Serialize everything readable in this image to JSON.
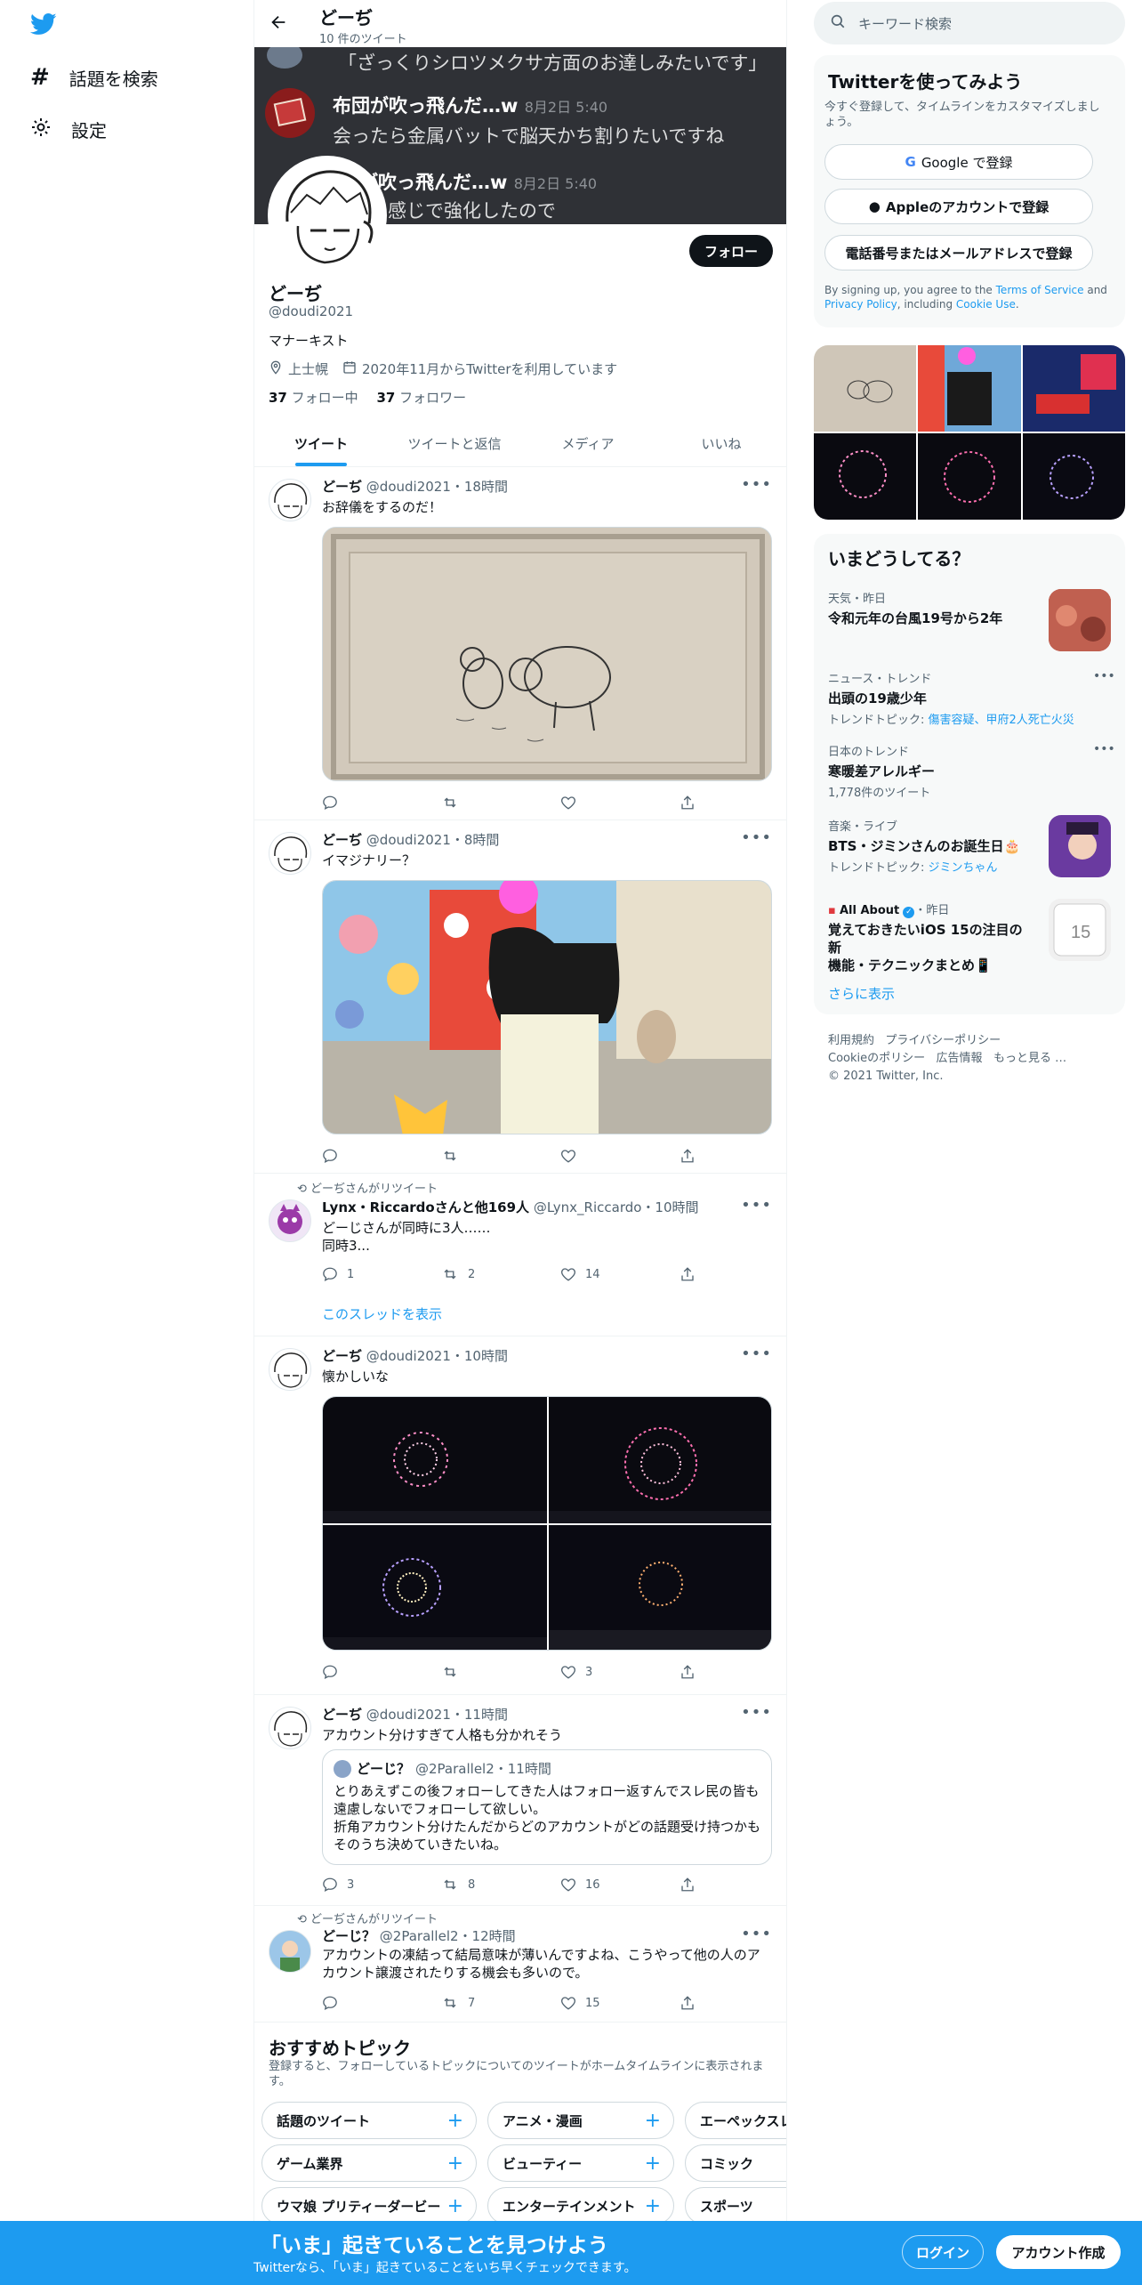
{
  "nav": {
    "explore": "話題を検索",
    "settings": "設定"
  },
  "header": {
    "name": "どーぢ",
    "count": "10 件のツイート"
  },
  "banner": {
    "line1": "「ざっくりシロツメクサ方面のお達しみたいです」",
    "msg1_user": "布団が吹っ飛んだ…w",
    "msg1_date": "8月2日 5:40",
    "msg1_text": "会ったら金属バットで脳天かち割りたいですね",
    "msg2_user": "が吹っ飛んだ…w",
    "msg2_date": "8月2日 5:40",
    "msg2_text": "感じで強化したので"
  },
  "profile": {
    "follow": "フォロー",
    "name": "どーぢ",
    "handle": "@doudi2021",
    "bio": "マナーキスト",
    "location": "上士幌",
    "joined": "2020年11月からTwitterを利用しています",
    "following_n": "37",
    "following_l": "フォロー中",
    "followers_n": "37",
    "followers_l": "フォロワー"
  },
  "tabs": [
    "ツイート",
    "ツイートと返信",
    "メディア",
    "いいね"
  ],
  "tweets": [
    {
      "name": "どーぢ",
      "meta": "@doudi2021・18時間",
      "text": "お辞儀をするのだ！"
    },
    {
      "name": "どーぢ",
      "meta": "@doudi2021・8時間",
      "text": "イマジナリー？"
    },
    {
      "rt": "どーぢさんがリツイート",
      "name": "Lynx・Riccardoさんと他169人",
      "meta": "@Lynx_Riccardo・10時間",
      "text1": "どーじさんが同時に3人……",
      "text2": "同時3...",
      "replies": "1",
      "retweets": "2",
      "likes": "14",
      "thread": "このスレッドを表示"
    },
    {
      "name": "どーぢ",
      "meta": "@doudi2021・10時間",
      "text": "懐かしいな",
      "likes": "3"
    },
    {
      "name": "どーぢ",
      "meta": "@doudi2021・11時間",
      "text": "アカウント分けすぎて人格も分かれそう",
      "q_name": "どーじ？",
      "q_meta": "@2Parallel2・11時間",
      "q_l1": "とりあえずこの後フォローしてきた人はフォロー返すんでスレ民の皆も",
      "q_l2": "遠慮しないでフォローして欲しい。",
      "q_l3": "折角アカウント分けたんだからどのアカウントがどの話題受け持つかも",
      "q_l4": "そのうち決めていきたいね。",
      "replies": "3",
      "retweets": "8",
      "likes": "16"
    },
    {
      "rt": "どーぢさんがリツイート",
      "name": "どーじ？",
      "meta": "@2Parallel2・12時間",
      "l1": "アカウントの凍結って結局意味が薄いんですよね、こうやって他の人のア",
      "l2": "カウント譲渡されたりする機会も多いので。",
      "retweets": "7",
      "likes": "15"
    }
  ],
  "topics": {
    "title": "おすすめトピック",
    "sub1": "登録すると、フォローしているトピックについてのツイートがホームタイムラインに表示されま",
    "sub2": "す。",
    "row1": [
      "話題のツイート",
      "アニメ・漫画",
      "エーペックスレ"
    ],
    "row2": [
      "ゲーム業界",
      "ビューティー",
      "コミック"
    ],
    "row3": [
      "ウマ娘 プリティーダービー",
      "エンターテインメント",
      "スポーツ"
    ]
  },
  "search": {
    "placeholder": "キーワード検索"
  },
  "signup": {
    "title": "Twitterを使ってみよう",
    "desc1": "今すぐ登録して、タイムラインをカスタマイズしまし",
    "desc2": "ょう。",
    "google": "Google で登録",
    "apple": "Appleのアカウントで登録",
    "phone": "電話番号またはメールアドレスで登録",
    "legal_a": "By signing up, you agree to the ",
    "legal_tos": "Terms of Service",
    "legal_b": " and",
    "legal_privacy": "Privacy Policy",
    "legal_c": ", including ",
    "legal_cookie": "Cookie Use",
    "legal_d": "."
  },
  "trends": {
    "title": "いまどうしてる？",
    "t1_cat": "天気・昨日",
    "t1_title": "令和元年の台風19号から2年",
    "t2_cat": "ニュース・トレンド",
    "t2_title": "出頭の19歳少年",
    "t2_sub_l": "トレンドトピック: ",
    "t2_sub": "傷害容疑、甲府2人死亡火災",
    "t3_cat": "日本のトレンド",
    "t3_title": "寒暖差アレルギー",
    "t3_count": "1,778件のツイート",
    "t4_cat": "音楽・ライブ",
    "t4_title": "BTS・ジミンさんのお誕生日🎂",
    "t4_sub_l": "トレンドトピック: ",
    "t4_sub": "ジミンちゃん",
    "t5_src": "All About",
    "t5_time": "・昨日",
    "t5_l1": "覚えておきたいiOS 15の注目の新",
    "t5_l2": "機能・テクニックまとめ📱",
    "more": "さらに表示"
  },
  "footer": {
    "l1a": "利用規約",
    "l1b": "プライバシーポリシー",
    "l2a": "Cookieのポリシー",
    "l2b": "広告情報",
    "l2c": "もっと見る …",
    "copy": "© 2021 Twitter, Inc."
  },
  "bottom": {
    "title": "「いま」起きていることを見つけよう",
    "sub": "Twitterなら、「いま」起きていることをいち早くチェックできます。",
    "login": "ログイン",
    "signup": "アカウント作成"
  }
}
